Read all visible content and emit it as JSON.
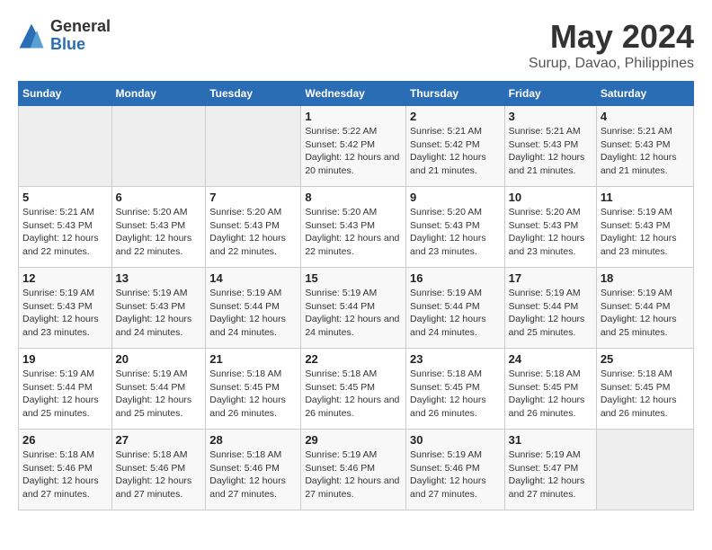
{
  "header": {
    "logo_general": "General",
    "logo_blue": "Blue",
    "month_title": "May 2024",
    "location": "Surup, Davao, Philippines"
  },
  "days_of_week": [
    "Sunday",
    "Monday",
    "Tuesday",
    "Wednesday",
    "Thursday",
    "Friday",
    "Saturday"
  ],
  "weeks": [
    [
      {
        "day": "",
        "info": ""
      },
      {
        "day": "",
        "info": ""
      },
      {
        "day": "",
        "info": ""
      },
      {
        "day": "1",
        "info": "Sunrise: 5:22 AM\nSunset: 5:42 PM\nDaylight: 12 hours and 20 minutes."
      },
      {
        "day": "2",
        "info": "Sunrise: 5:21 AM\nSunset: 5:42 PM\nDaylight: 12 hours and 21 minutes."
      },
      {
        "day": "3",
        "info": "Sunrise: 5:21 AM\nSunset: 5:43 PM\nDaylight: 12 hours and 21 minutes."
      },
      {
        "day": "4",
        "info": "Sunrise: 5:21 AM\nSunset: 5:43 PM\nDaylight: 12 hours and 21 minutes."
      }
    ],
    [
      {
        "day": "5",
        "info": "Sunrise: 5:21 AM\nSunset: 5:43 PM\nDaylight: 12 hours and 22 minutes."
      },
      {
        "day": "6",
        "info": "Sunrise: 5:20 AM\nSunset: 5:43 PM\nDaylight: 12 hours and 22 minutes."
      },
      {
        "day": "7",
        "info": "Sunrise: 5:20 AM\nSunset: 5:43 PM\nDaylight: 12 hours and 22 minutes."
      },
      {
        "day": "8",
        "info": "Sunrise: 5:20 AM\nSunset: 5:43 PM\nDaylight: 12 hours and 22 minutes."
      },
      {
        "day": "9",
        "info": "Sunrise: 5:20 AM\nSunset: 5:43 PM\nDaylight: 12 hours and 23 minutes."
      },
      {
        "day": "10",
        "info": "Sunrise: 5:20 AM\nSunset: 5:43 PM\nDaylight: 12 hours and 23 minutes."
      },
      {
        "day": "11",
        "info": "Sunrise: 5:19 AM\nSunset: 5:43 PM\nDaylight: 12 hours and 23 minutes."
      }
    ],
    [
      {
        "day": "12",
        "info": "Sunrise: 5:19 AM\nSunset: 5:43 PM\nDaylight: 12 hours and 23 minutes."
      },
      {
        "day": "13",
        "info": "Sunrise: 5:19 AM\nSunset: 5:43 PM\nDaylight: 12 hours and 24 minutes."
      },
      {
        "day": "14",
        "info": "Sunrise: 5:19 AM\nSunset: 5:44 PM\nDaylight: 12 hours and 24 minutes."
      },
      {
        "day": "15",
        "info": "Sunrise: 5:19 AM\nSunset: 5:44 PM\nDaylight: 12 hours and 24 minutes."
      },
      {
        "day": "16",
        "info": "Sunrise: 5:19 AM\nSunset: 5:44 PM\nDaylight: 12 hours and 24 minutes."
      },
      {
        "day": "17",
        "info": "Sunrise: 5:19 AM\nSunset: 5:44 PM\nDaylight: 12 hours and 25 minutes."
      },
      {
        "day": "18",
        "info": "Sunrise: 5:19 AM\nSunset: 5:44 PM\nDaylight: 12 hours and 25 minutes."
      }
    ],
    [
      {
        "day": "19",
        "info": "Sunrise: 5:19 AM\nSunset: 5:44 PM\nDaylight: 12 hours and 25 minutes."
      },
      {
        "day": "20",
        "info": "Sunrise: 5:19 AM\nSunset: 5:44 PM\nDaylight: 12 hours and 25 minutes."
      },
      {
        "day": "21",
        "info": "Sunrise: 5:18 AM\nSunset: 5:45 PM\nDaylight: 12 hours and 26 minutes."
      },
      {
        "day": "22",
        "info": "Sunrise: 5:18 AM\nSunset: 5:45 PM\nDaylight: 12 hours and 26 minutes."
      },
      {
        "day": "23",
        "info": "Sunrise: 5:18 AM\nSunset: 5:45 PM\nDaylight: 12 hours and 26 minutes."
      },
      {
        "day": "24",
        "info": "Sunrise: 5:18 AM\nSunset: 5:45 PM\nDaylight: 12 hours and 26 minutes."
      },
      {
        "day": "25",
        "info": "Sunrise: 5:18 AM\nSunset: 5:45 PM\nDaylight: 12 hours and 26 minutes."
      }
    ],
    [
      {
        "day": "26",
        "info": "Sunrise: 5:18 AM\nSunset: 5:46 PM\nDaylight: 12 hours and 27 minutes."
      },
      {
        "day": "27",
        "info": "Sunrise: 5:18 AM\nSunset: 5:46 PM\nDaylight: 12 hours and 27 minutes."
      },
      {
        "day": "28",
        "info": "Sunrise: 5:18 AM\nSunset: 5:46 PM\nDaylight: 12 hours and 27 minutes."
      },
      {
        "day": "29",
        "info": "Sunrise: 5:19 AM\nSunset: 5:46 PM\nDaylight: 12 hours and 27 minutes."
      },
      {
        "day": "30",
        "info": "Sunrise: 5:19 AM\nSunset: 5:46 PM\nDaylight: 12 hours and 27 minutes."
      },
      {
        "day": "31",
        "info": "Sunrise: 5:19 AM\nSunset: 5:47 PM\nDaylight: 12 hours and 27 minutes."
      },
      {
        "day": "",
        "info": ""
      }
    ]
  ]
}
